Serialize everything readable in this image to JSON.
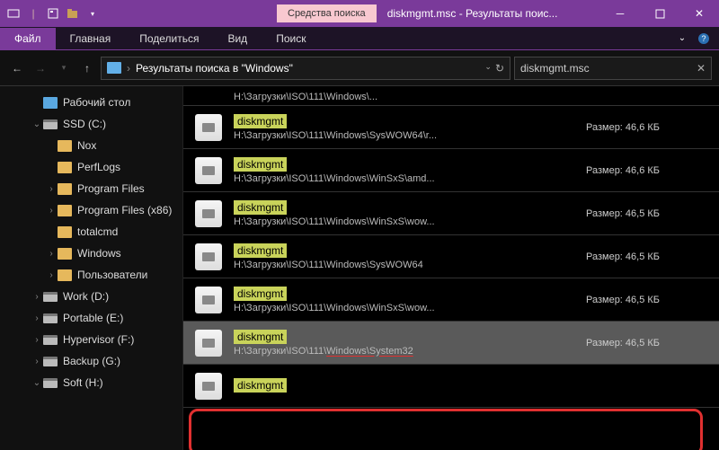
{
  "titlebar": {
    "contextual_tab": "Средства поиска",
    "title": "diskmgmt.msc - Результаты поис..."
  },
  "menubar": {
    "file": "Файл",
    "items": [
      "Главная",
      "Поделиться",
      "Вид",
      "Поиск"
    ]
  },
  "nav": {
    "breadcrumb": "Результаты поиска в \"Windows\"",
    "search_value": "diskmgmt.msc"
  },
  "tree": [
    {
      "depth": 1,
      "icon": "desktop",
      "label": "Рабочий стол",
      "exp": ""
    },
    {
      "depth": 1,
      "icon": "drive",
      "label": "SSD (C:)",
      "exp": "v"
    },
    {
      "depth": 2,
      "icon": "folder",
      "label": "Nox",
      "exp": ""
    },
    {
      "depth": 2,
      "icon": "folder",
      "label": "PerfLogs",
      "exp": ""
    },
    {
      "depth": 2,
      "icon": "folder",
      "label": "Program Files",
      "exp": ">"
    },
    {
      "depth": 2,
      "icon": "folder",
      "label": "Program Files (x86)",
      "exp": ">"
    },
    {
      "depth": 2,
      "icon": "folder",
      "label": "totalcmd",
      "exp": ""
    },
    {
      "depth": 2,
      "icon": "folder",
      "label": "Windows",
      "exp": ">"
    },
    {
      "depth": 2,
      "icon": "folder",
      "label": "Пользователи",
      "exp": ">"
    },
    {
      "depth": 1,
      "icon": "drive",
      "label": "Work (D:)",
      "exp": ">"
    },
    {
      "depth": 1,
      "icon": "drive",
      "label": "Portable (E:)",
      "exp": ">"
    },
    {
      "depth": 1,
      "icon": "drive",
      "label": "Hypervisor (F:)",
      "exp": ">"
    },
    {
      "depth": 1,
      "icon": "drive",
      "label": "Backup (G:)",
      "exp": ">"
    },
    {
      "depth": 1,
      "icon": "drive",
      "label": "Soft (H:)",
      "exp": "v"
    }
  ],
  "results": [
    {
      "name": "diskmgmt",
      "path": "H:\\Загрузки\\ISO\\111\\Windows\\SysWOW64\\r...",
      "size": "Размер: 46,6 КБ"
    },
    {
      "name": "diskmgmt",
      "path": "H:\\Загрузки\\ISO\\111\\Windows\\WinSxS\\amd...",
      "size": "Размер: 46,6 КБ"
    },
    {
      "name": "diskmgmt",
      "path": "H:\\Загрузки\\ISO\\111\\Windows\\WinSxS\\wow...",
      "size": "Размер: 46,5 КБ"
    },
    {
      "name": "diskmgmt",
      "path": "H:\\Загрузки\\ISO\\111\\Windows\\SysWOW64",
      "size": "Размер: 46,5 КБ"
    },
    {
      "name": "diskmgmt",
      "path": "H:\\Загрузки\\ISO\\111\\Windows\\WinSxS\\wow...",
      "size": "Размер: 46,5 КБ"
    },
    {
      "name": "diskmgmt",
      "path_prefix": "H:\\Загрузки\\ISO\\111\\",
      "path_ul": "Windows\\System32",
      "size": "Размер: 46,5 КБ",
      "selected": true
    },
    {
      "name": "diskmgmt",
      "path": "",
      "size": ""
    }
  ],
  "truncated_path_fragment": "H:\\Загрузки\\ISO\\111\\Windows\\..."
}
